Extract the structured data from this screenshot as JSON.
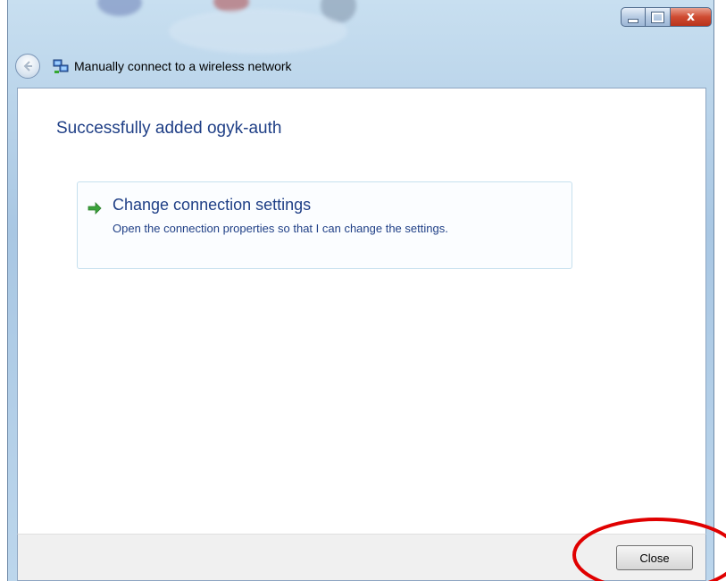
{
  "window": {
    "title": "Manually connect to a wireless network",
    "caption": {
      "close_glyph": "x"
    }
  },
  "content": {
    "heading": "Successfully added ogyk-auth",
    "task": {
      "title": "Change connection settings",
      "description": "Open the connection properties so that I can change the settings."
    }
  },
  "footer": {
    "close_label": "Close"
  },
  "colors": {
    "heading": "#1f3f86",
    "arrow": "#3aa33a",
    "annotation": "#e00000"
  }
}
